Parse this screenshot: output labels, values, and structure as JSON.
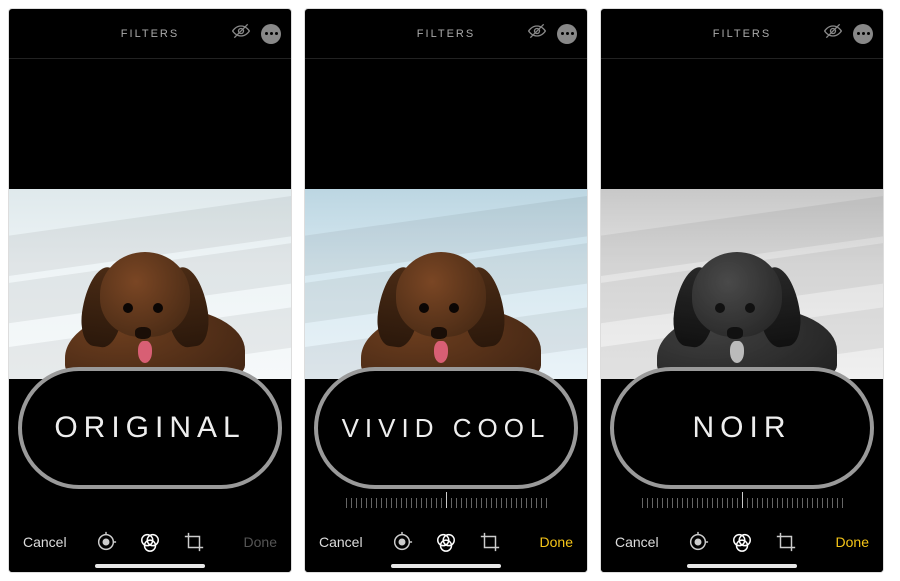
{
  "screens": [
    {
      "header": {
        "title": "FILTERS"
      },
      "filter_label": "ORIGINAL",
      "photo_variant": "original",
      "show_slider": false,
      "footer": {
        "cancel": "Cancel",
        "done": "Done",
        "done_active": false
      }
    },
    {
      "header": {
        "title": "FILTERS"
      },
      "filter_label": "VIVID COOL",
      "photo_variant": "cool",
      "show_slider": true,
      "footer": {
        "cancel": "Cancel",
        "done": "Done",
        "done_active": true
      }
    },
    {
      "header": {
        "title": "FILTERS"
      },
      "filter_label": "NOIR",
      "photo_variant": "bw",
      "show_slider": true,
      "footer": {
        "cancel": "Cancel",
        "done": "Done",
        "done_active": true
      }
    }
  ],
  "icons": {
    "hide": "eye-slash-icon",
    "more": "more-icon",
    "adjust": "adjust-icon",
    "filters": "filters-icon",
    "crop": "crop-icon"
  }
}
